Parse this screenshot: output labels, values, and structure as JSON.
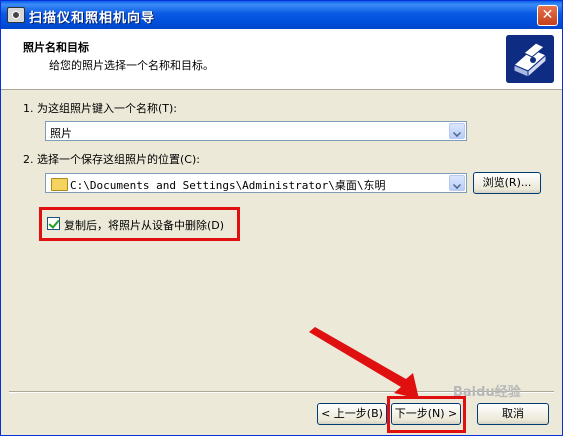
{
  "window": {
    "title": "扫描仪和照相机向导",
    "close_label": "✕"
  },
  "header": {
    "title": "照片名和目标",
    "subtitle": "给您的照片选择一个名称和目标。",
    "icon": "camera-wizard-icon"
  },
  "step1": {
    "label": "1. 为这组照片键入一个名称(T):",
    "value": "照片"
  },
  "step2": {
    "label": "2. 选择一个保存这组照片的位置(C):",
    "path": "C:\\Documents and Settings\\Administrator\\桌面\\东明",
    "browse_label": "浏览(R)..."
  },
  "options": {
    "delete_after_copy_label": "复制后，将照片从设备中删除(D)",
    "delete_after_copy_checked": true
  },
  "footer": {
    "back_label": "< 上一步(B)",
    "next_label": "下一步(N) >",
    "cancel_label": "取消"
  },
  "watermark": "Baidu经验",
  "colors": {
    "highlight": "#e01010",
    "titlebar": "#0a5ae4"
  }
}
